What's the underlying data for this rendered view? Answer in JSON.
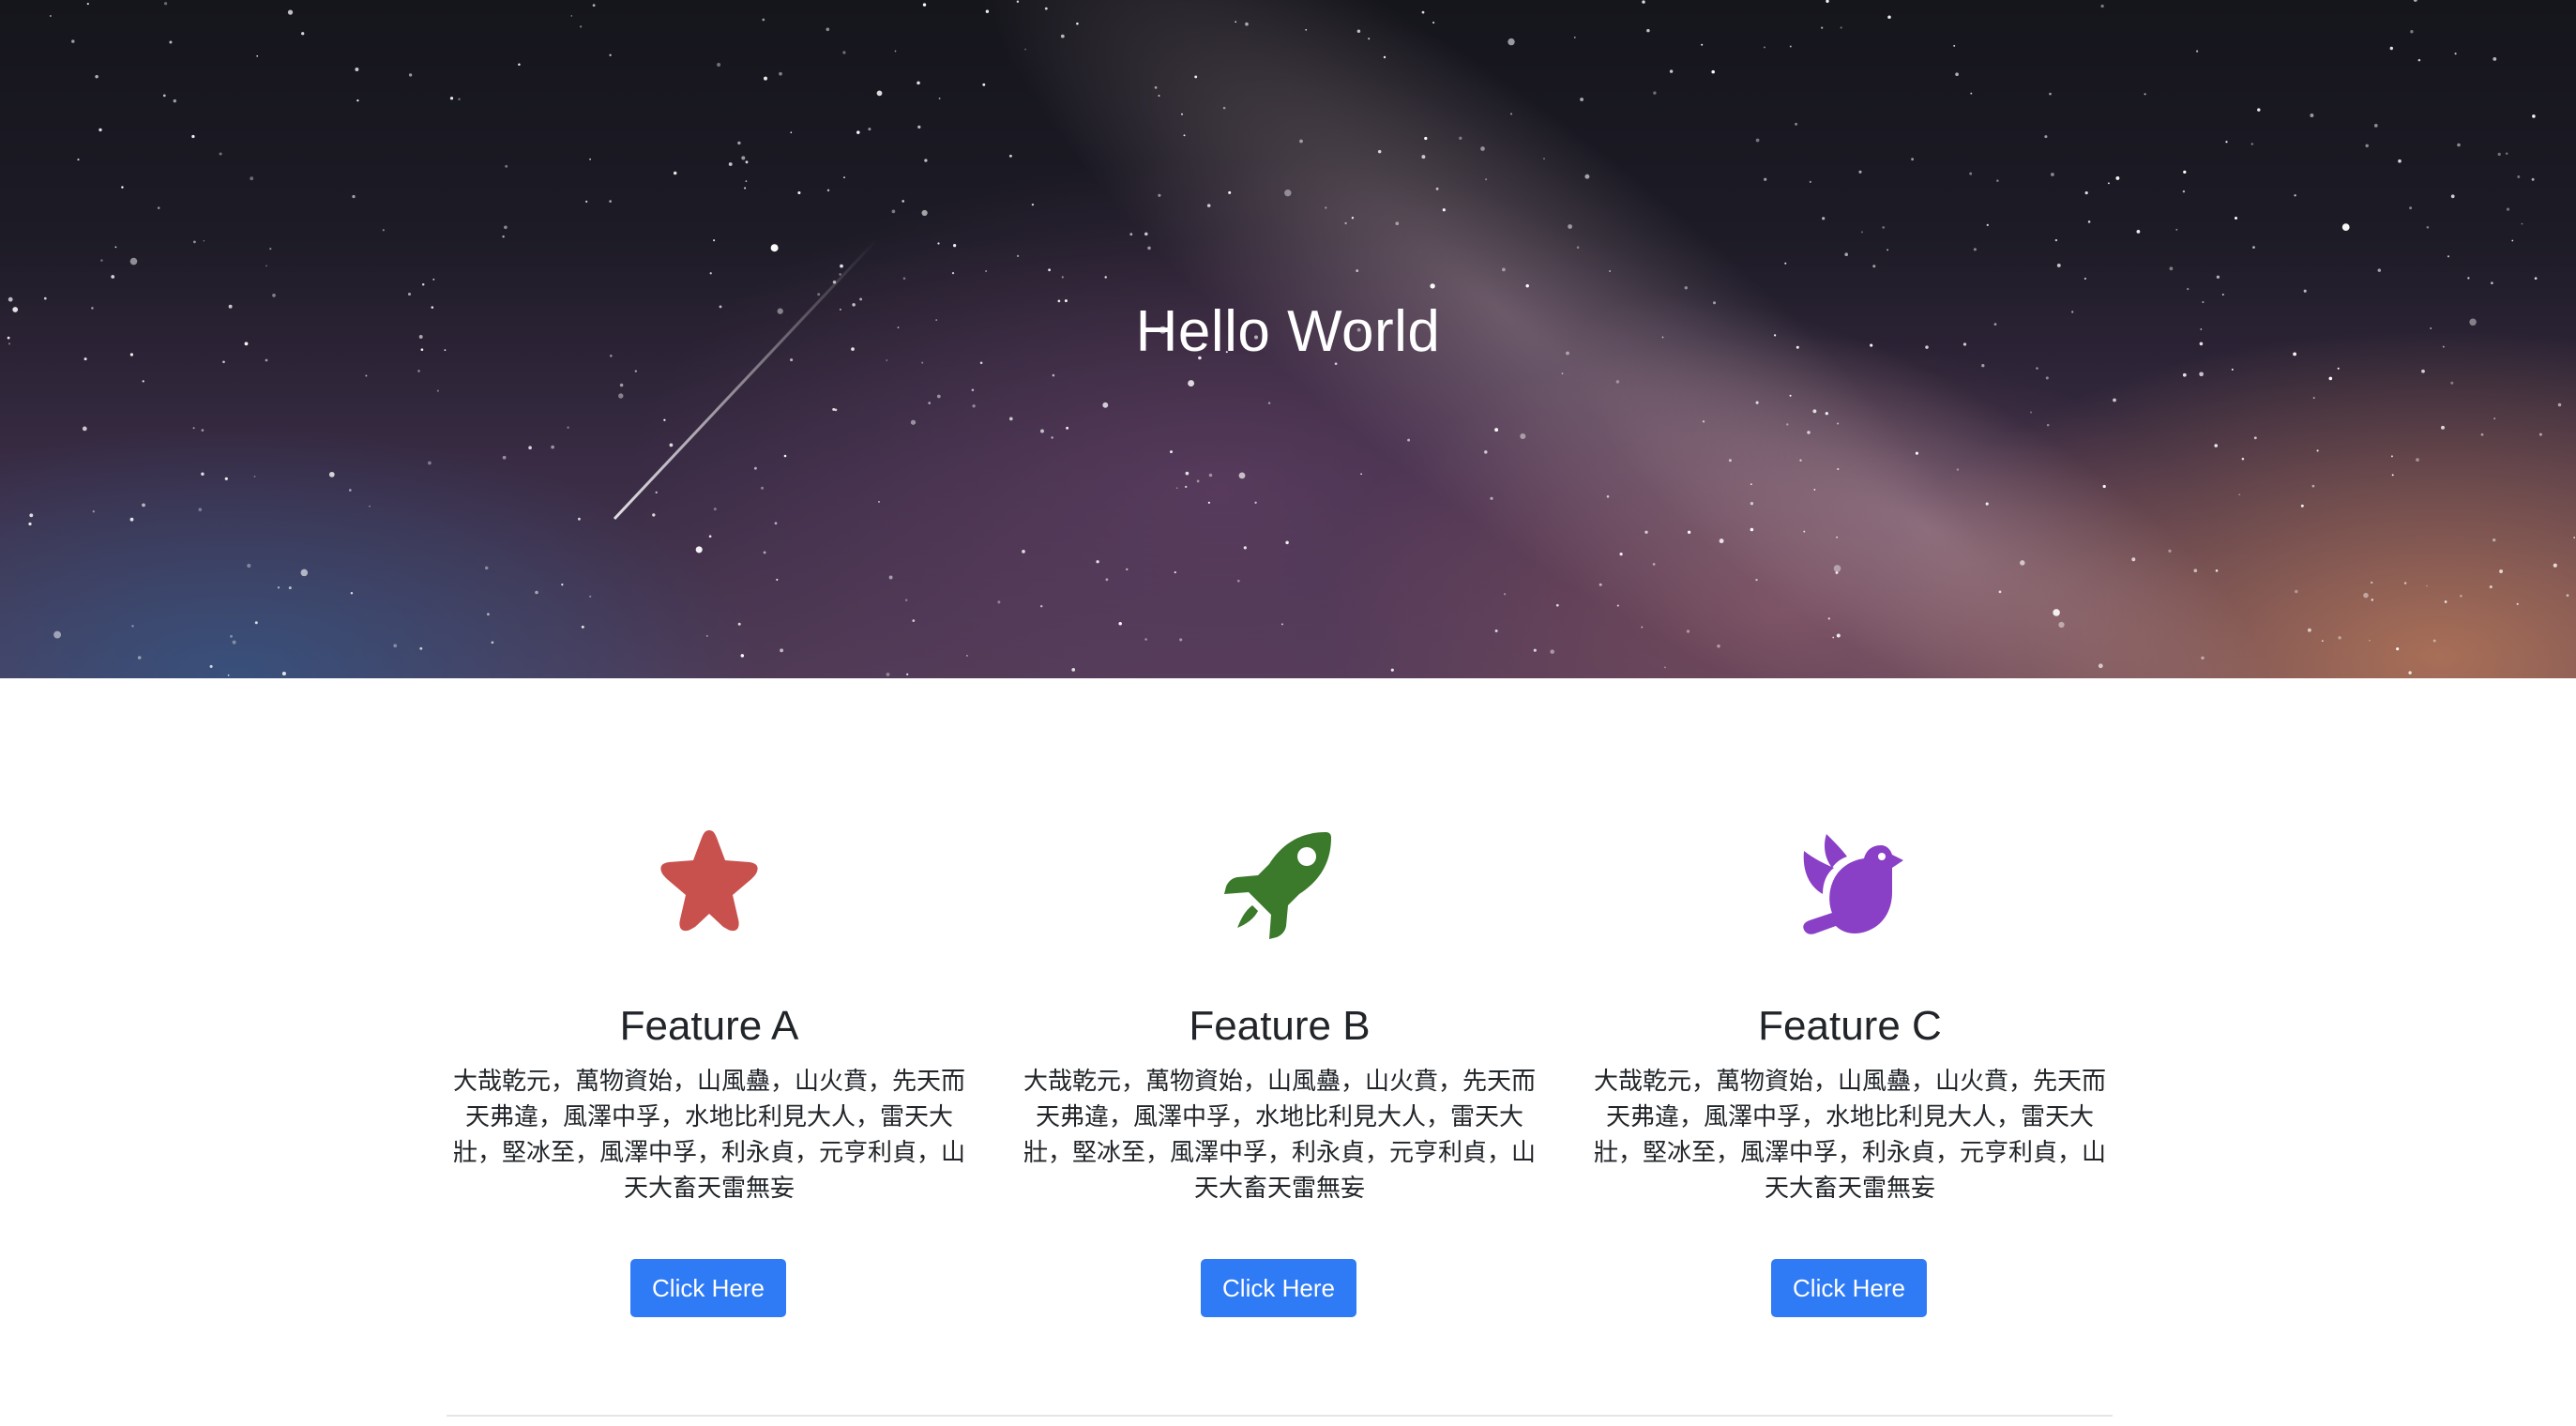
{
  "hero": {
    "title": "Hello World"
  },
  "features": [
    {
      "icon": "star-icon",
      "icon_color": "#c9514d",
      "title": "Feature A",
      "text": "大哉乾元，萬物資始，山風蠱，山火賁，先天而天弗違，風澤中孚，水地比利見大人，雷天大壯，堅冰至，風澤中孚，利永貞，元亨利貞，山天大畜天雷無妄",
      "button_label": "Click Here"
    },
    {
      "icon": "rocket-icon",
      "icon_color": "#3b7a2a",
      "title": "Feature B",
      "text": "大哉乾元，萬物資始，山風蠱，山火賁，先天而天弗違，風澤中孚，水地比利見大人，雷天大壯，堅冰至，風澤中孚，利永貞，元亨利貞，山天大畜天雷無妄",
      "button_label": "Click Here"
    },
    {
      "icon": "dove-icon",
      "icon_color": "#8a3fc7",
      "title": "Feature C",
      "text": "大哉乾元，萬物資始，山風蠱，山火賁，先天而天弗違，風澤中孚，水地比利見大人，雷天大壯，堅冰至，風澤中孚，利永貞，元亨利貞，山天大畜天雷無妄",
      "button_label": "Click Here"
    }
  ],
  "colors": {
    "button": "#2f7bf5",
    "text": "#212529"
  }
}
